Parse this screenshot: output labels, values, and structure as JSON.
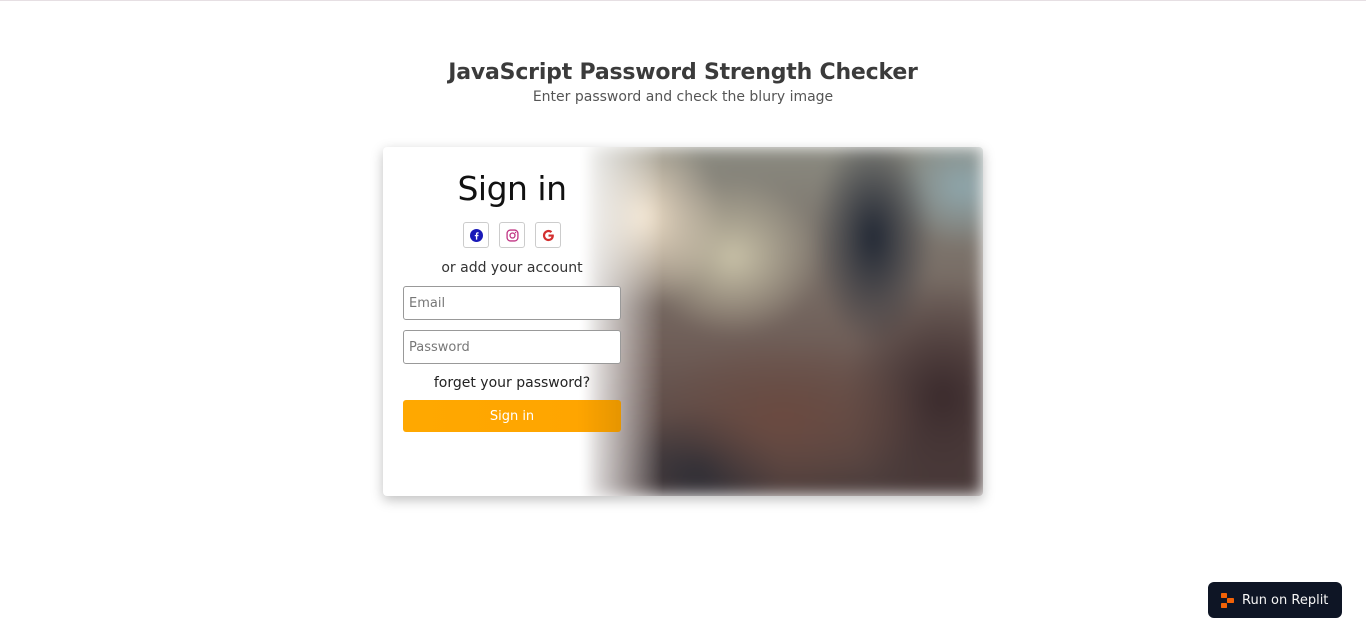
{
  "header": {
    "title": "JavaScript Password Strength Checker",
    "subtitle": "Enter password and check the blury image"
  },
  "form": {
    "title": "Sign in",
    "socials": [
      {
        "icon": "facebook-icon",
        "color": "#1a1ab8"
      },
      {
        "icon": "instagram-icon",
        "color": "#c13584"
      },
      {
        "icon": "google-icon",
        "color": "#d32f2f"
      }
    ],
    "subtext": "or add your account",
    "email_placeholder": "Email",
    "password_placeholder": "Password",
    "forgot_label": "forget your password?",
    "signin_label": "Sign in"
  },
  "replit": {
    "label": "Run on Replit",
    "accent": "#f26207"
  }
}
